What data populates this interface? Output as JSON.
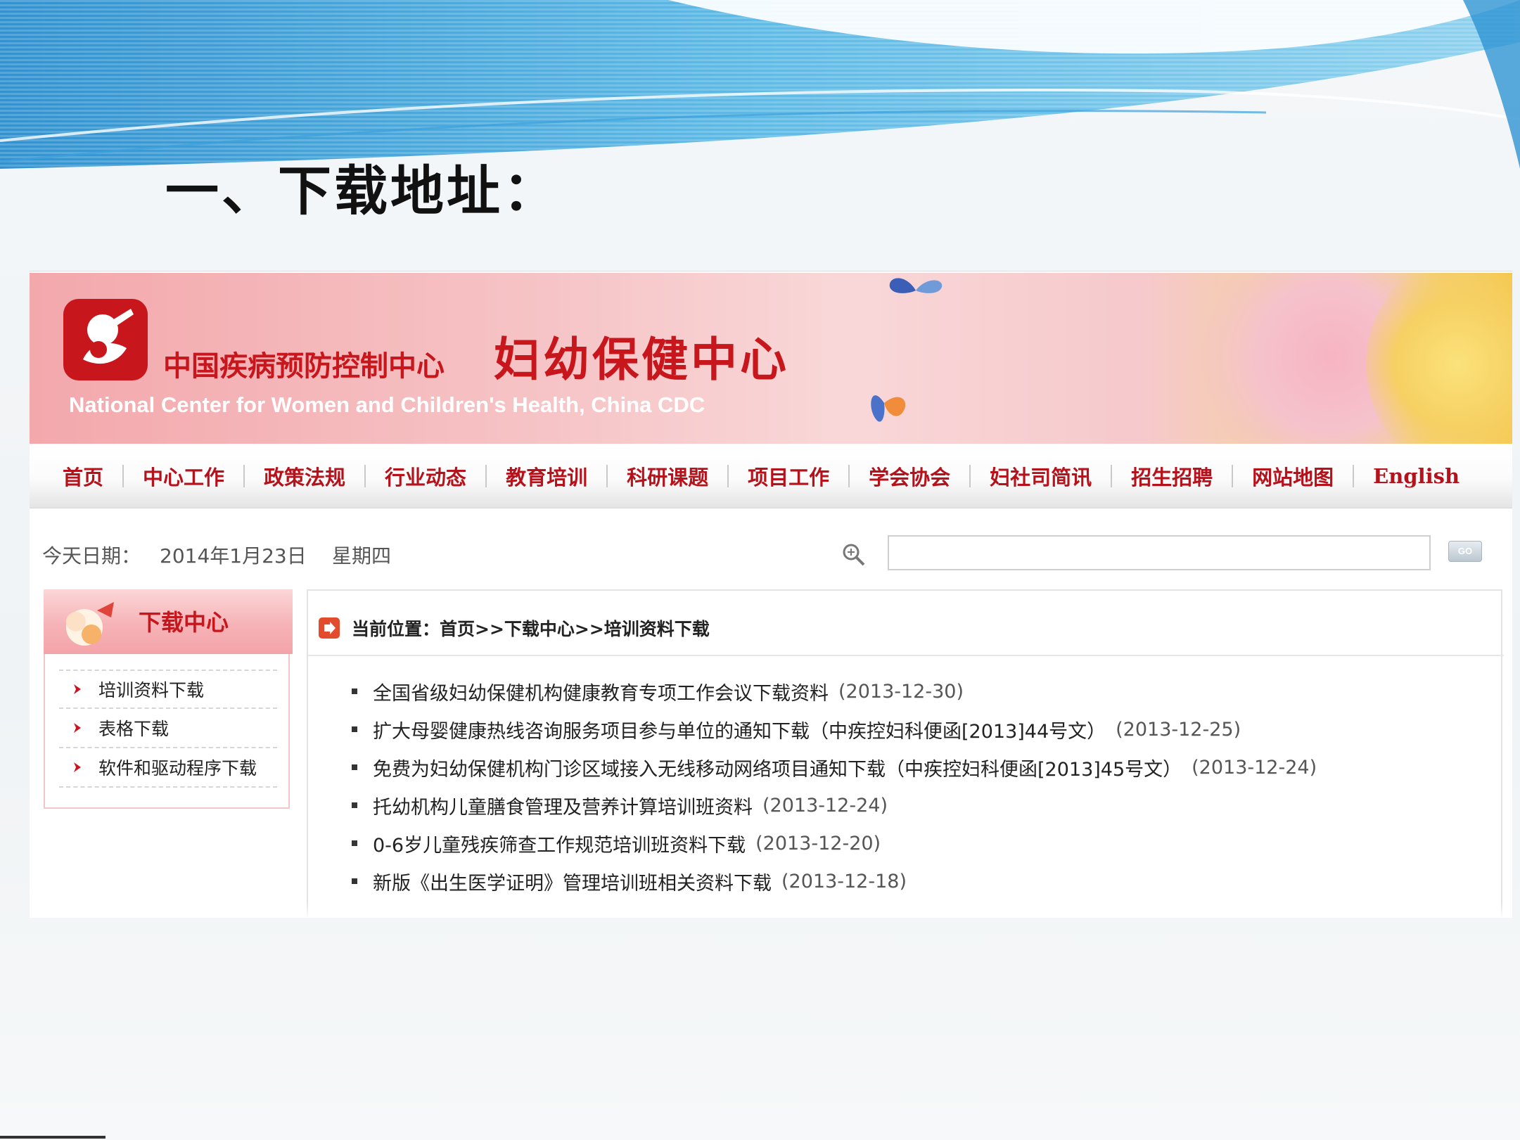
{
  "slide": {
    "title": "一、下载地址："
  },
  "banner": {
    "cn_small": "中国疾病预防控制中心",
    "cn_big": "妇幼保健中心",
    "en": "National Center for Women and Children's Health, China CDC",
    "logo_icon": "mother-child-logo-icon"
  },
  "nav": {
    "items": [
      "首页",
      "中心工作",
      "政策法规",
      "行业动态",
      "教育培训",
      "科研课题",
      "项目工作",
      "学会协会",
      "妇社司简讯",
      "招生招聘",
      "网站地图",
      "English"
    ]
  },
  "info": {
    "date_label": "今天日期：",
    "date_value": "2014年1月23日",
    "weekday": "星期四",
    "search_value": "",
    "go_label": "GO"
  },
  "sidebar": {
    "title": "下载中心",
    "items": [
      "培训资料下载",
      "表格下载",
      "软件和驱动程序下载"
    ]
  },
  "content": {
    "breadcrumb_label": "当前位置：",
    "breadcrumb_path": "首页>>下载中心>>培训资料下载",
    "documents": [
      {
        "title": "全国省级妇幼保健机构健康教育专项工作会议下载资料",
        "date": "(2013-12-30)"
      },
      {
        "title": "扩大母婴健康热线咨询服务项目参与单位的通知下载（中疾控妇科便函[2013]44号文）",
        "date": "(2013-12-25)"
      },
      {
        "title": "免费为妇幼保健机构门诊区域接入无线移动网络项目通知下载（中疾控妇科便函[2013]45号文）",
        "date": "(2013-12-24)"
      },
      {
        "title": "托幼机构儿童膳食管理及营养计算培训班资料",
        "date": "(2013-12-24)"
      },
      {
        "title": "0-6岁儿童残疾筛查工作规范培训班资料下载",
        "date": "(2013-12-20)"
      },
      {
        "title": "新版《出生医学证明》管理培训班相关资料下载",
        "date": "(2013-12-18)"
      }
    ]
  },
  "colors": {
    "brand_red": "#c8161d",
    "nav_red": "#b5121b",
    "banner_pink": "#f3a8ac",
    "wave_blue": "#3fa9e0"
  }
}
